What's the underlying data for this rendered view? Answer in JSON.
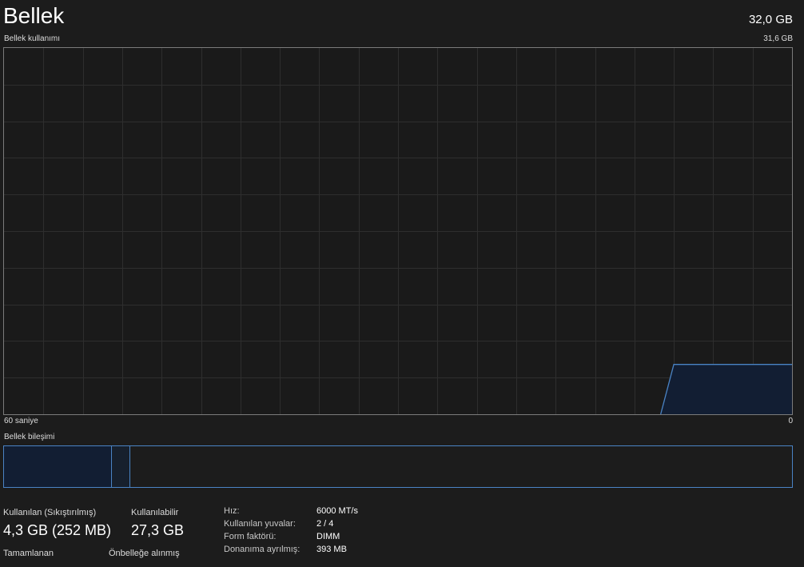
{
  "header": {
    "title": "Bellek",
    "total": "32,0 GB",
    "usage_label": "Bellek kullanımı",
    "usage_max": "31,6 GB"
  },
  "graph": {
    "time_left": "60 saniye",
    "time_right": "0",
    "line_color": "#4a83c4",
    "fill_color": "#121e33",
    "grid_color": "#2e2e2e",
    "samples": [
      0,
      0,
      0,
      0,
      0,
      0,
      0,
      0,
      0,
      0,
      0,
      0,
      0,
      0,
      0,
      0,
      0,
      0,
      0,
      0,
      0,
      0,
      0,
      0,
      0,
      0,
      0,
      0,
      0,
      0,
      0,
      0,
      0,
      0,
      0,
      0,
      0,
      0,
      0,
      0,
      0,
      0,
      0,
      0,
      0,
      0,
      0,
      0,
      0,
      0,
      0,
      4.3,
      4.3,
      4.3,
      4.3,
      4.3,
      4.3,
      4.3,
      4.3,
      4.3,
      4.3
    ],
    "max_gb": 31.6
  },
  "composition": {
    "label": "Bellek bileşimi",
    "used_fraction": 0.137,
    "modified_fraction": 0.023
  },
  "stats": {
    "used_label": "Kullanılan (Sıkıştırılmış)",
    "used_value": "4,3 GB (252 MB)",
    "available_label": "Kullanılabilir",
    "available_value": "27,3 GB",
    "committed_label": "Tamamlanan",
    "cached_label": "Önbelleğe alınmış"
  },
  "details": {
    "speed_label": "Hız:",
    "speed_value": "6000 MT/s",
    "slots_label": "Kullanılan yuvalar:",
    "slots_value": "2 / 4",
    "form_label": "Form faktörü:",
    "form_value": "DIMM",
    "reserved_label": "Donanıma ayrılmış:",
    "reserved_value": "393 MB"
  }
}
